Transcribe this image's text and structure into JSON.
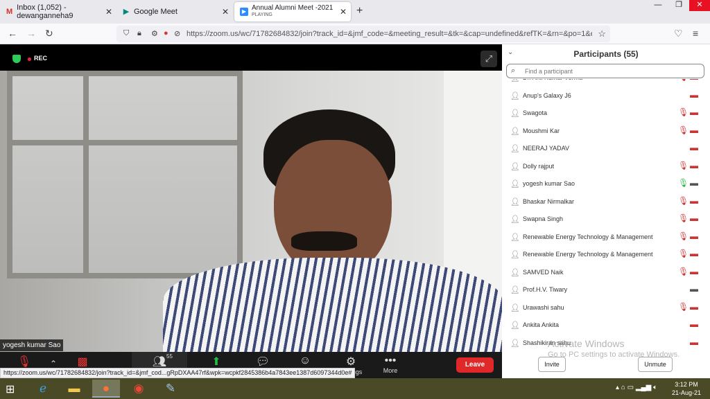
{
  "tabs": [
    {
      "label": "Inbox (1,052) - dewanganneha9",
      "icon": "gmail-icon"
    },
    {
      "label": "Google Meet",
      "icon": "meet-icon"
    },
    {
      "label": "Annual Alumni Meet -2021",
      "sub": "PLAYING",
      "icon": "zoom-icon"
    }
  ],
  "url": "https://zoom.us/wc/71782684832/join?track_id=&jmf_code=&meeting_result=&tk=&cap=undefined&refTK=&rn=&po=1&ep",
  "video": {
    "rec_label": "REC",
    "speaker_name": "yogesh kumar Sao"
  },
  "toolbar": {
    "participant_count": "55",
    "settings_label": "Settings",
    "more_label": "More",
    "leave_label": "Leave"
  },
  "status_url": "https://zoom.us/wc/71782684832/join?track_id=&jmf_cod...gRpDXAA47rf&wpk=wcpkf2845386b4a7843ee1387d6097344d0e#",
  "participants": {
    "title": "Participants (55)",
    "search_placeholder": "Find a participant",
    "items": [
      {
        "name": "Dr. Anil Kumar Verma",
        "mic": "muted",
        "cam": "off"
      },
      {
        "name": "Anup's Galaxy J6",
        "mic": "none",
        "cam": "off"
      },
      {
        "name": "Swagota",
        "mic": "muted",
        "cam": "off"
      },
      {
        "name": "Moushmi Kar",
        "mic": "muted",
        "cam": "off"
      },
      {
        "name": "NEERAJ YADAV",
        "mic": "none",
        "cam": "off"
      },
      {
        "name": "Dolly rajput",
        "mic": "muted",
        "cam": "off"
      },
      {
        "name": "yogesh kumar Sao",
        "mic": "on",
        "cam": "on"
      },
      {
        "name": "Bhaskar Nirmalkar",
        "mic": "muted",
        "cam": "off"
      },
      {
        "name": "Swapna Singh",
        "mic": "muted",
        "cam": "off"
      },
      {
        "name": "Renewable Energy Technology & Management",
        "mic": "muted",
        "cam": "off"
      },
      {
        "name": "Renewable Energy Technology & Management",
        "mic": "muted",
        "cam": "off"
      },
      {
        "name": "SAMVED Naik",
        "mic": "muted",
        "cam": "off"
      },
      {
        "name": "Prof.H.V. Tiwary",
        "mic": "none",
        "cam": "on"
      },
      {
        "name": "Urawashi sahu",
        "mic": "muted",
        "cam": "off"
      },
      {
        "name": "Ankita Ankita",
        "mic": "none",
        "cam": "off"
      },
      {
        "name": "Shashikiran sahu",
        "mic": "none",
        "cam": "off"
      }
    ],
    "invite_label": "Invite",
    "unmute_label": "Unmute"
  },
  "watermark": {
    "line1": "Activate Windows",
    "line2": "Go to PC settings to activate Windows."
  },
  "clock": {
    "time": "3:12 PM",
    "date": "21-Aug-21"
  }
}
